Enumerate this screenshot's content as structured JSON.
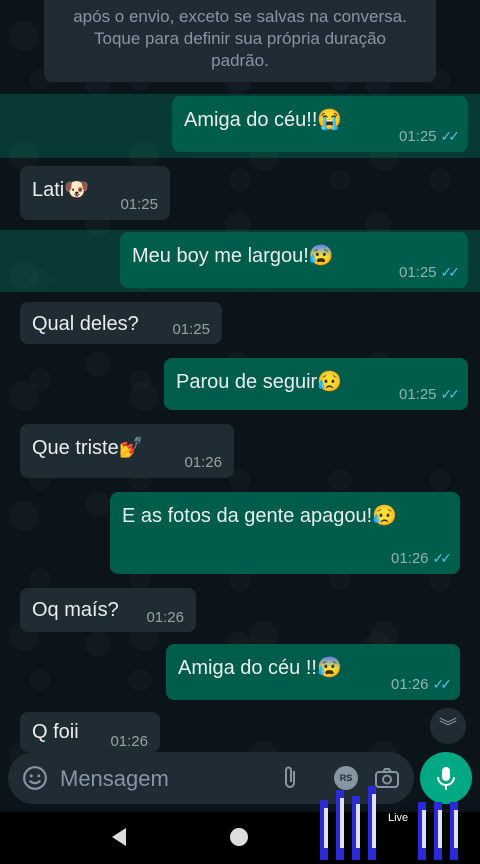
{
  "notice": {
    "lines": [
      "após o envio, exceto se salvas na conversa.",
      "Toque para definir sua própria duração",
      "padrão."
    ]
  },
  "messages": [
    {
      "dir": "out",
      "text": "Amiga do céu!!",
      "emoji": "😭",
      "time": "01:25"
    },
    {
      "dir": "in",
      "text": "Lati",
      "emoji": "🐶",
      "time": "01:25"
    },
    {
      "dir": "out",
      "text": "Meu boy me largou!",
      "emoji": "😰",
      "time": "01:25"
    },
    {
      "dir": "in",
      "text": "Qual deles?",
      "emoji": "",
      "time": "01:25"
    },
    {
      "dir": "out",
      "text": "Parou de seguir",
      "emoji": "😥",
      "time": "01:25"
    },
    {
      "dir": "in",
      "text": "Que triste",
      "emoji": "💅",
      "time": "01:26"
    },
    {
      "dir": "out",
      "text": "E as fotos da gente apagou!",
      "emoji": "😥",
      "time": "01:26"
    },
    {
      "dir": "in",
      "text": "Oq maís?",
      "emoji": "",
      "time": "01:26"
    },
    {
      "dir": "out",
      "text": "Amiga do céu !!",
      "emoji": "😰",
      "time": "01:26"
    },
    {
      "dir": "in",
      "text": "Q foii",
      "emoji": "",
      "time": "01:26"
    }
  ],
  "composer": {
    "placeholder": "Mensagem",
    "rs_label": "RS"
  },
  "watermark": {
    "text": "Live"
  },
  "icons": {
    "emoji": "emoji-icon",
    "attach": "paperclip-icon",
    "camera": "camera-icon",
    "mic": "microphone-icon",
    "scroll": "chevron-double-down-icon"
  },
  "colors": {
    "outgoing_bubble": "#005c4b",
    "incoming_bubble": "#202c33",
    "accent": "#00a884",
    "read_ticks": "#53bdeb"
  }
}
